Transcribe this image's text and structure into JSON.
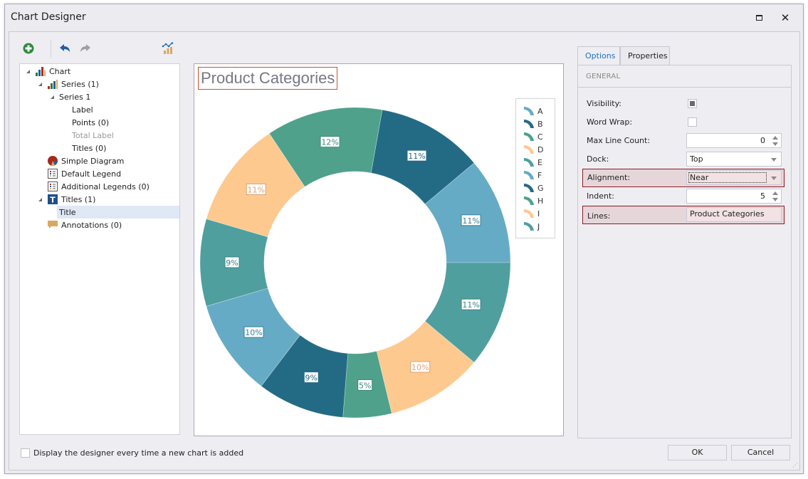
{
  "window": {
    "title": "Chart Designer",
    "maximize_icon": "maximize-icon",
    "close_icon": "close-icon"
  },
  "toolbar": {
    "add_icon": "add-icon",
    "undo_icon": "undo-icon",
    "redo_icon": "redo-icon",
    "wizard_icon": "chart-wizard-icon"
  },
  "tree": {
    "items": [
      {
        "label": "Chart",
        "level": 0,
        "expanded": true,
        "icon": "chart-icon"
      },
      {
        "label": "Series (1)",
        "level": 1,
        "expanded": true,
        "icon": "series-icon"
      },
      {
        "label": "Series 1",
        "level": 2,
        "expanded": true,
        "icon": ""
      },
      {
        "label": "Label",
        "level": 3,
        "icon": ""
      },
      {
        "label": "Points (0)",
        "level": 3,
        "icon": ""
      },
      {
        "label": "Total Label",
        "level": 3,
        "icon": "",
        "disabled": true
      },
      {
        "label": "Titles (0)",
        "level": 3,
        "icon": ""
      },
      {
        "label": "Simple Diagram",
        "level": 1,
        "icon": "diagram-icon"
      },
      {
        "label": "Default Legend",
        "level": 1,
        "icon": "legend-icon"
      },
      {
        "label": "Additional Legends (0)",
        "level": 1,
        "icon": "legend-icon"
      },
      {
        "label": "Titles (1)",
        "level": 1,
        "expanded": true,
        "icon": "title-icon"
      },
      {
        "label": "Title",
        "level": 2,
        "icon": "",
        "selected": true
      },
      {
        "label": "Annotations (0)",
        "level": 1,
        "icon": "annotation-icon"
      }
    ]
  },
  "chart_data": {
    "type": "pie",
    "variant": "donut",
    "title": "Product Categories",
    "categories": [
      "A",
      "B",
      "C",
      "D",
      "E",
      "F",
      "G",
      "H",
      "I",
      "J"
    ],
    "values": [
      11,
      11,
      12,
      11,
      9,
      10,
      9,
      5,
      10,
      11
    ],
    "labels": [
      "11%",
      "11%",
      "12%",
      "11%",
      "9%",
      "10%",
      "9%",
      "5%",
      "10%",
      "11%"
    ],
    "colors": [
      "#66abc5",
      "#236b84",
      "#4fa18b",
      "#fec98f",
      "#4f9f9f",
      "#66abc5",
      "#236b84",
      "#4fa18b",
      "#fec98f",
      "#4f9f9f"
    ],
    "label_text_colors": [
      "#3a7e9a",
      "#236b84",
      "#3c8a76",
      "#e0a070",
      "#3a8585",
      "#3a7e9a",
      "#236b84",
      "#3c8a76",
      "#e0a070",
      "#3a8585"
    ],
    "start_angle_deg": 0,
    "direction": "counterclockwise",
    "legend_position": "top-right"
  },
  "properties": {
    "tabs": [
      {
        "label": "Options",
        "active": true
      },
      {
        "label": "Properties",
        "active": false
      }
    ],
    "section": "GENERAL",
    "rows": {
      "visibility": {
        "label": "Visibility:",
        "checked": true
      },
      "word_wrap": {
        "label": "Word Wrap:",
        "checked": false
      },
      "max_line_count": {
        "label": "Max Line Count:",
        "value": "0"
      },
      "dock": {
        "label": "Dock:",
        "value": "Top"
      },
      "alignment": {
        "label": "Alignment:",
        "value": "Near"
      },
      "indent": {
        "label": "Indent:",
        "value": "5"
      },
      "lines": {
        "label": "Lines:",
        "value": "Product Categories"
      }
    }
  },
  "footer": {
    "checkbox_label": "Display the designer every time a new chart is added",
    "checkbox_checked": false,
    "ok_label": "OK",
    "cancel_label": "Cancel"
  }
}
